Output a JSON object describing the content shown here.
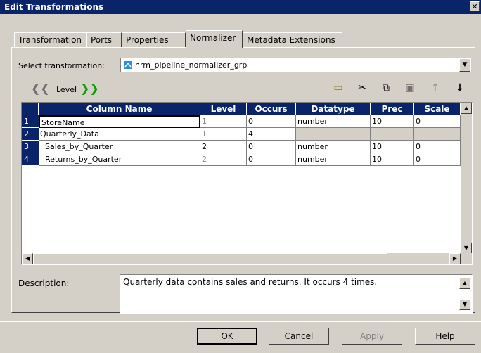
{
  "window": {
    "title": "Edit Transformations",
    "close_glyph": "✕"
  },
  "tabs": [
    {
      "label": "Transformation",
      "active": false
    },
    {
      "label": "Ports",
      "active": false
    },
    {
      "label": "Properties",
      "active": false
    },
    {
      "label": "Normalizer",
      "active": true
    },
    {
      "label": "Metadata Extensions",
      "active": false
    }
  ],
  "select_transformation": {
    "label": "Select transformation:",
    "value": "nrm_pipeline_normalizer_grp"
  },
  "level_nav": {
    "left_glyph": "❮❮",
    "label": "Level",
    "right_glyph": "❯❯"
  },
  "toolbar": {
    "new": "▭",
    "cut": "✂",
    "copy": "⧉",
    "paste": "▣",
    "up": "↑",
    "down": "↓"
  },
  "grid": {
    "headers": [
      "Column Name",
      "Level",
      "Occurs",
      "Datatype",
      "Prec",
      "Scale"
    ],
    "rows": [
      {
        "num": "1",
        "name": "StoreName",
        "level": "1",
        "occurs": "0",
        "datatype": "number",
        "prec": "10",
        "scale": "0"
      },
      {
        "num": "2",
        "name": "Quarterly_Data",
        "level": "1",
        "occurs": "4",
        "datatype": "",
        "prec": "",
        "scale": ""
      },
      {
        "num": "3",
        "name": "  Sales_by_Quarter",
        "level": "2",
        "occurs": "0",
        "datatype": "number",
        "prec": "10",
        "scale": "0"
      },
      {
        "num": "4",
        "name": "  Returns_by_Quarter",
        "level": "2",
        "occurs": "0",
        "datatype": "number",
        "prec": "10",
        "scale": "0"
      }
    ]
  },
  "description": {
    "label": "Description:",
    "text": "Quarterly data contains sales and returns. It occurs 4 times."
  },
  "buttons": {
    "ok": "OK",
    "cancel": "Cancel",
    "apply": "Apply",
    "help": "Help"
  }
}
